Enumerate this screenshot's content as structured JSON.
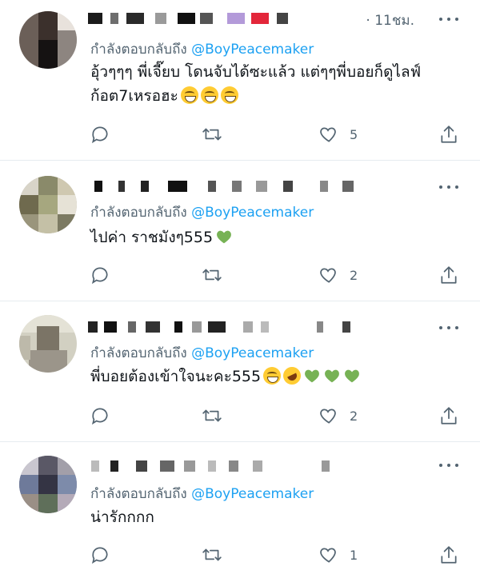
{
  "tweets": [
    {
      "time": "· 11ชม.",
      "reply_prefix": "กำลังตอบกลับถึง",
      "reply_handle": "@BoyPeacemaker",
      "line1": "อุ้วๆๆๆ พี่เจี๊ยบ โดนจับได้ซะแล้ว แต่ๆๆพี่บอยก็ดูไลฟ์",
      "line2": "ก้อต7เหรอฮะ",
      "likes": "5"
    },
    {
      "reply_prefix": "กำลังตอบกลับถึง",
      "reply_handle": "@BoyPeacemaker",
      "line1": "ไปค่า ราชมังๆ555",
      "likes": "2"
    },
    {
      "reply_prefix": "กำลังตอบกลับถึง",
      "reply_handle": "@BoyPeacemaker",
      "line1": "พี่บอยต้องเข้าใจนะคะ555",
      "likes": "2"
    },
    {
      "reply_prefix": "กำลังตอบกลับถึง",
      "reply_handle": "@BoyPeacemaker",
      "line1": "น่ารักกกก",
      "likes": "1"
    }
  ],
  "icons": {
    "reply": "comment-icon",
    "retweet": "retweet-icon",
    "like": "heart-icon",
    "share": "share-icon",
    "more": "more-icon"
  },
  "colors": {
    "handle_blue": "#1da1f2",
    "secondary_gray": "#536471",
    "green_heart": "#77b255",
    "divider": "#e6ecf0"
  }
}
